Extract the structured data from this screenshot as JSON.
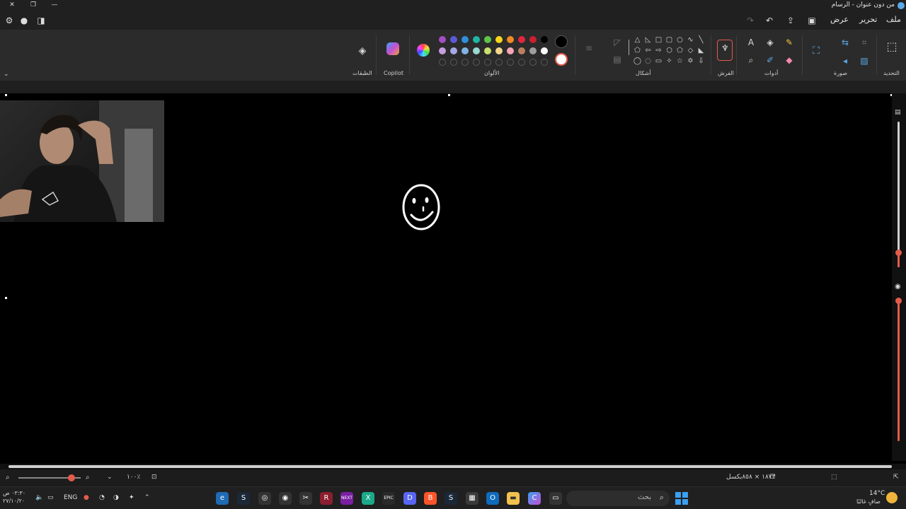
{
  "window": {
    "title": "من دون عنوان - الرسام",
    "minimize": "—",
    "restore": "❐",
    "close": "✕"
  },
  "menu": {
    "file": "ملف",
    "edit": "تحرير",
    "view": "عرض"
  },
  "ribbon": {
    "select_label": "التحديد",
    "image_label": "صورة",
    "tools_label": "أدوات",
    "brushes_label": "الفرش",
    "shapes_label": "أشكال",
    "colors_label": "الألوان",
    "copilot_label": "Copilot",
    "layers_label": "الطبقات"
  },
  "colors": {
    "accent": "#e45b4b",
    "palette_row1": [
      "#000000",
      "#c9212f",
      "#e0263f",
      "#f08a24",
      "#f7d61b",
      "#5cc64a",
      "#1fb5a3",
      "#2f8fdc",
      "#5b5bd6",
      "#a34ec4"
    ],
    "palette_row2": [
      "#ffffff",
      "#9e9e9e",
      "#b88063",
      "#f4a5b6",
      "#f4d58c",
      "#c7e26b",
      "#9ad8d1",
      "#7fb3e3",
      "#a7a7e6",
      "#c79de0"
    ],
    "primary": "#000000",
    "secondary": "#ffffff"
  },
  "status": {
    "dimensions": "١٨٧٣ × ٨٥٨بكسل",
    "zoom": "١٠٠٪"
  },
  "taskbar": {
    "search_placeholder": "بحث",
    "language": "ENG",
    "time": "٠٣:٣٠ ص",
    "date": "٢٧/١٠/٢٠",
    "temperature": "14°C",
    "weather": "صافٍ غالبًا"
  }
}
